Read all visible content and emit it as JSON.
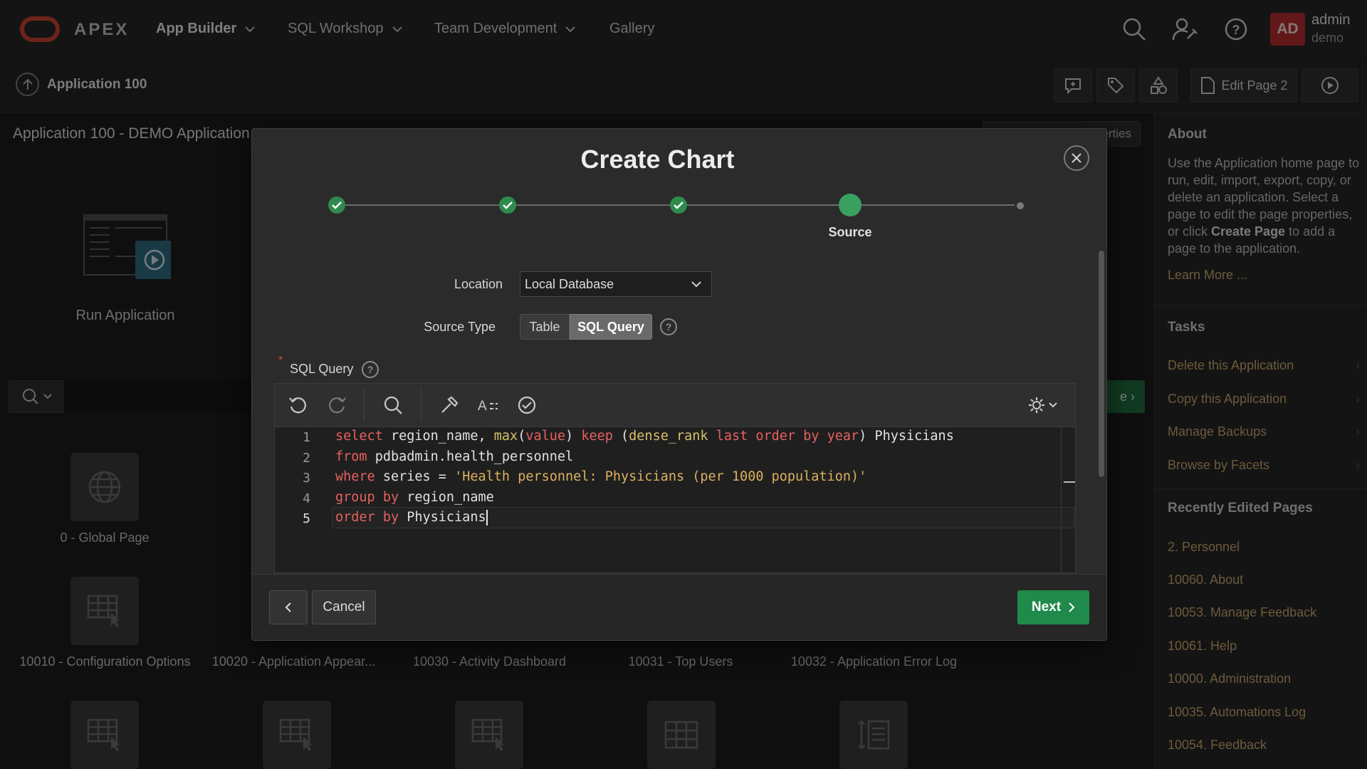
{
  "nav": {
    "brand": "APEX",
    "items": [
      {
        "label": "App Builder",
        "active": true
      },
      {
        "label": "SQL Workshop",
        "active": false
      },
      {
        "label": "Team Development",
        "active": false
      },
      {
        "label": "Gallery",
        "active": false
      }
    ],
    "user": {
      "initials": "AD",
      "name": "admin",
      "workspace": "demo"
    },
    "icons": [
      "search-icon",
      "admin-icon",
      "help-icon"
    ]
  },
  "breadcrumb": {
    "label": "Application 100"
  },
  "toolbar": {
    "edit_page_label": "Edit Page 2"
  },
  "page": {
    "title": "Application 100 - DEMO Application",
    "properties_button": "Edit Application Properties",
    "run_application": "Run Application",
    "next_ghost": "e",
    "tiles": [
      {
        "label": "0 - Global Page",
        "icon": "globe-icon"
      },
      {
        "label": "10010 - Configuration Options",
        "icon": "form-icon"
      },
      {
        "label": "10020 - Application Appear...",
        "icon": "form-icon"
      },
      {
        "label": "10030 - Activity Dashboard",
        "icon": "form-icon"
      },
      {
        "label": "10031 - Top Users",
        "icon": "form-icon"
      },
      {
        "label": "10032 - Application Error Log",
        "icon": "form-icon"
      }
    ]
  },
  "sidebar": {
    "about_heading": "About",
    "about_text_1": "Use the Application home page to run, edit, import, export, copy, or delete an application. Select a page to edit the page properties, or click ",
    "about_bold": "Create Page",
    "about_text_2": " to add a page to the application.",
    "learn_more": "Learn More ...",
    "tasks_heading": "Tasks",
    "tasks": [
      "Delete this Application",
      "Copy this Application",
      "Manage Backups",
      "Browse by Facets"
    ],
    "recent_heading": "Recently Edited Pages",
    "recent": [
      "2. Personnel",
      "10060. About",
      "10053. Manage Feedback",
      "10061. Help",
      "10000. Administration",
      "10035. Automations Log",
      "10054. Feedback"
    ]
  },
  "dialog": {
    "title": "Create Chart",
    "current_step": "Source",
    "location_label": "Location",
    "location_value": "Local Database",
    "source_type_label": "Source Type",
    "source_type_options": [
      "Table",
      "SQL Query"
    ],
    "source_type_selected": "SQL Query",
    "sql_query_label": "SQL Query",
    "line_numbers": [
      "1",
      "2",
      "3",
      "4",
      "5"
    ],
    "cancel_label": "Cancel",
    "next_label": "Next"
  },
  "colors": {
    "accent_green": "#1f8a4b",
    "link": "#c3a56c",
    "keyword": "#e86060",
    "avatar": "#b32c2c"
  }
}
